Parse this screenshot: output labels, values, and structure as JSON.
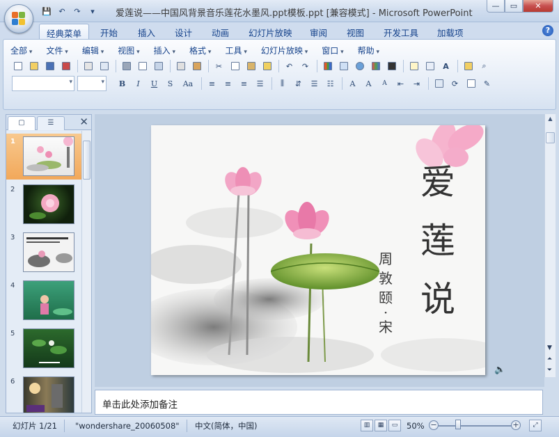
{
  "window": {
    "title": "爱莲说——中国风背景音乐莲花水墨风.ppt模板.ppt [兼容模式] - Microsoft PowerPoint",
    "min": "—",
    "max": "▭",
    "close": "✕"
  },
  "qat": {
    "save": "💾",
    "undo": "↶",
    "redo": "↷",
    "more": "▾"
  },
  "ribbon_tabs": [
    "经典菜单",
    "开始",
    "插入",
    "设计",
    "动画",
    "幻灯片放映",
    "审阅",
    "视图",
    "开发工具",
    "加载项"
  ],
  "help": "?",
  "classic_menu": [
    "全部",
    "文件",
    "编辑",
    "视图",
    "插入",
    "格式",
    "工具",
    "幻灯片放映",
    "窗口",
    "帮助"
  ],
  "toolbar_row1": [
    "📄",
    "📂",
    "💾",
    "📑",
    "📋",
    "🖫",
    "🖨",
    "🔍",
    "🔲",
    "🔤",
    "📖",
    "✂",
    "⎘",
    "📋",
    "🖌",
    "↶",
    "↷",
    "📊",
    "▦",
    "🌐",
    "▣",
    "▬",
    "📑",
    "▤",
    "A",
    "📁",
    "🔍"
  ],
  "toolbar_row2": [
    "B",
    "I",
    "U",
    "S",
    "Aa",
    "≡",
    "≡",
    "≡",
    "≡",
    "⋮",
    "⇵",
    "☰",
    "☷",
    "A",
    "A",
    "A",
    "⇤",
    "⇥",
    "▭",
    "⟳",
    "▭",
    "🖉"
  ],
  "left_panel": {
    "close": "✕",
    "slides": [
      {
        "num": "1",
        "selected": true
      },
      {
        "num": "2",
        "selected": false
      },
      {
        "num": "3",
        "selected": false
      },
      {
        "num": "4",
        "selected": false
      },
      {
        "num": "5",
        "selected": false
      },
      {
        "num": "6",
        "selected": false
      }
    ]
  },
  "slide": {
    "title_chars": [
      "爱",
      "莲",
      "说"
    ],
    "author_chars": [
      "周",
      "敦",
      "颐",
      "·",
      "宋"
    ]
  },
  "notes_placeholder": "单击此处添加备注",
  "status": {
    "slide_counter": "幻灯片 1/21",
    "theme": "\"wondershare_20060508\"",
    "language": "中文(简体，中国)",
    "zoom": "50%",
    "zoom_fraction": 0.5
  }
}
